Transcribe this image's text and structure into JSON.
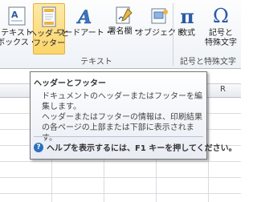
{
  "ribbon": {
    "buttons": [
      {
        "label": "テキスト\nボックス・",
        "icon": "text-box-icon"
      },
      {
        "label": "ヘッダーと\nフッター",
        "icon": "header-footer-icon"
      },
      {
        "label": "ワードアート・",
        "icon": "wordart-icon"
      },
      {
        "label": "署名欄・",
        "icon": "signature-line-icon"
      },
      {
        "label": "オブジェクト",
        "icon": "object-icon"
      },
      {
        "label": "数式",
        "icon": "equation-icon",
        "glyph": "π"
      },
      {
        "label": "記号と\n特殊文字",
        "icon": "symbol-icon",
        "glyph": "Ω"
      }
    ],
    "groups": {
      "text": "テキスト",
      "symbols": "記号と特殊文字"
    },
    "colors": {
      "accent": "#fbd56a",
      "help_icon": "#2a6fbf"
    }
  },
  "sheet": {
    "col_letter": "R"
  },
  "tooltip": {
    "title": "ヘッダーとフッター",
    "body1": "ドキュメントのヘッダーまたはフッターを編集します。",
    "body2": "ヘッダーまたはフッターの情報は、印刷結果の各ページの上部または下部に表示されます。",
    "help": "ヘルプを表示するには、F1 キーを押してください。"
  }
}
